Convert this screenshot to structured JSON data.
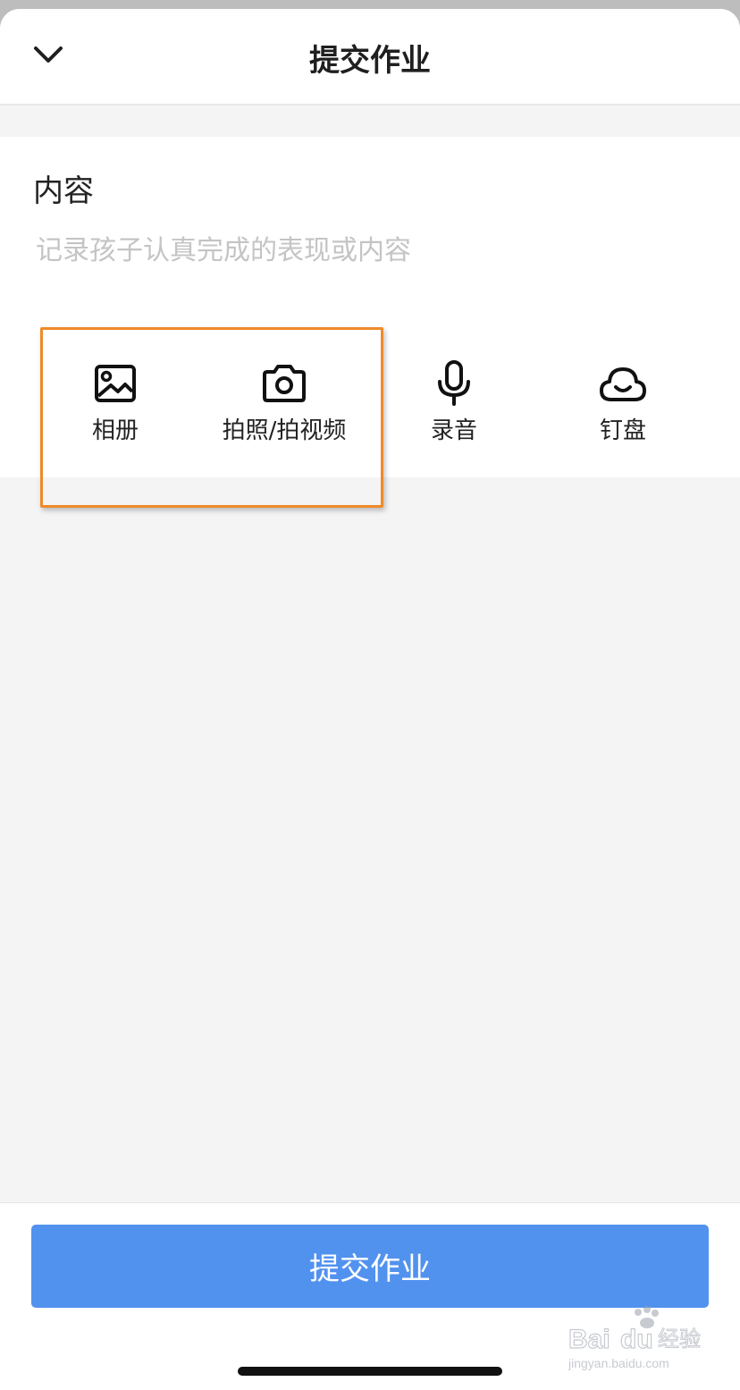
{
  "header": {
    "title": "提交作业"
  },
  "content": {
    "label": "内容",
    "placeholder": "记录孩子认真完成的表现或内容"
  },
  "tools": [
    {
      "label": "相册",
      "icon": "image-icon"
    },
    {
      "label": "拍照/拍视频",
      "icon": "camera-icon"
    },
    {
      "label": "录音",
      "icon": "microphone-icon"
    },
    {
      "label": "钉盘",
      "icon": "cloud-icon"
    }
  ],
  "footer": {
    "submit_label": "提交作业"
  },
  "colors": {
    "accent": "#5292ef",
    "highlight": "#ef8a2a"
  },
  "watermark": {
    "brand": "Baidu经验",
    "url": "jingyan.baidu.com"
  }
}
